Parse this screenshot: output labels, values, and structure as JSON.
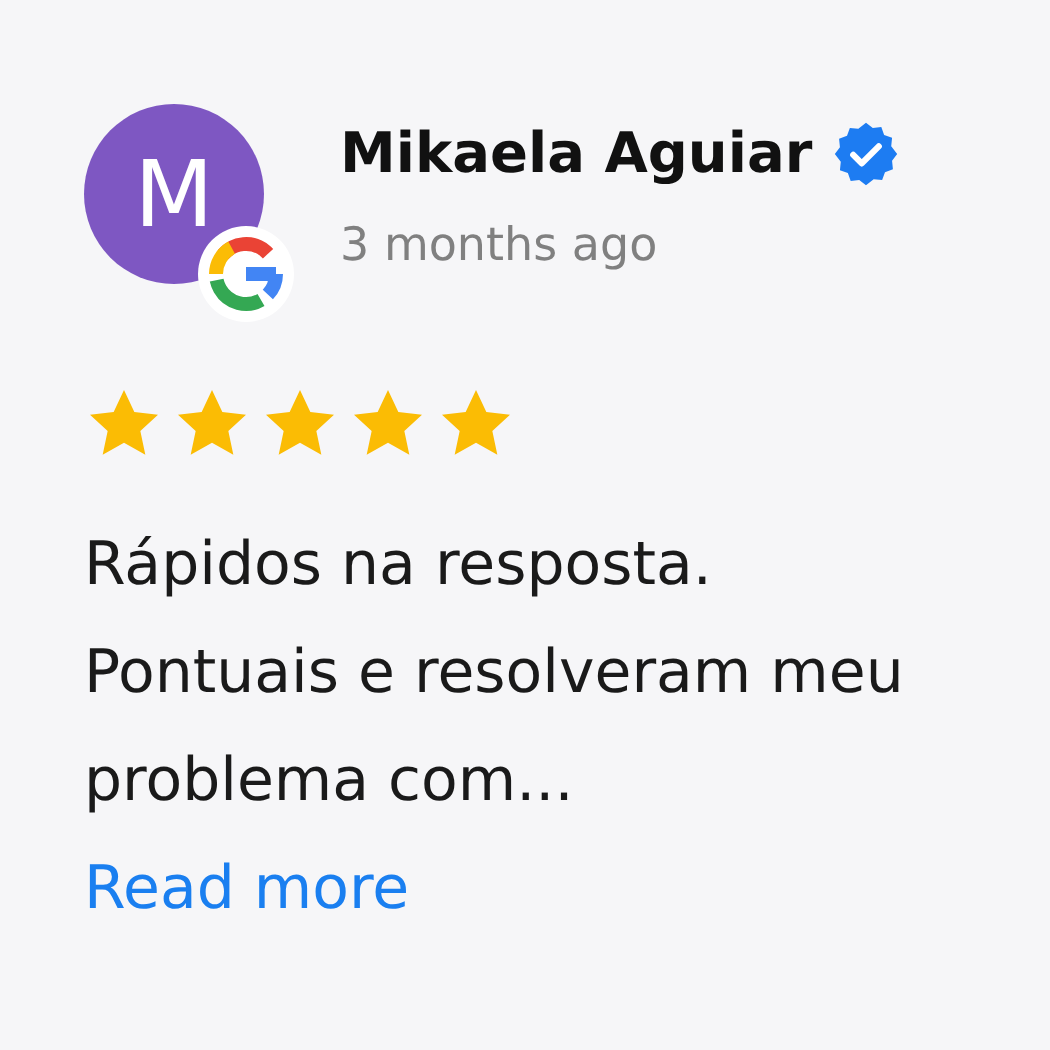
{
  "review": {
    "avatar": {
      "initial": "M",
      "color": "#7e57c2"
    },
    "source_badge": true,
    "name": "Mikaela Aguiar",
    "verified": true,
    "time": "3 months ago",
    "stars": 5,
    "text": "Rápidos na resposta. Pontuais e resolveram meu problema com...",
    "read_more": "Read more"
  }
}
